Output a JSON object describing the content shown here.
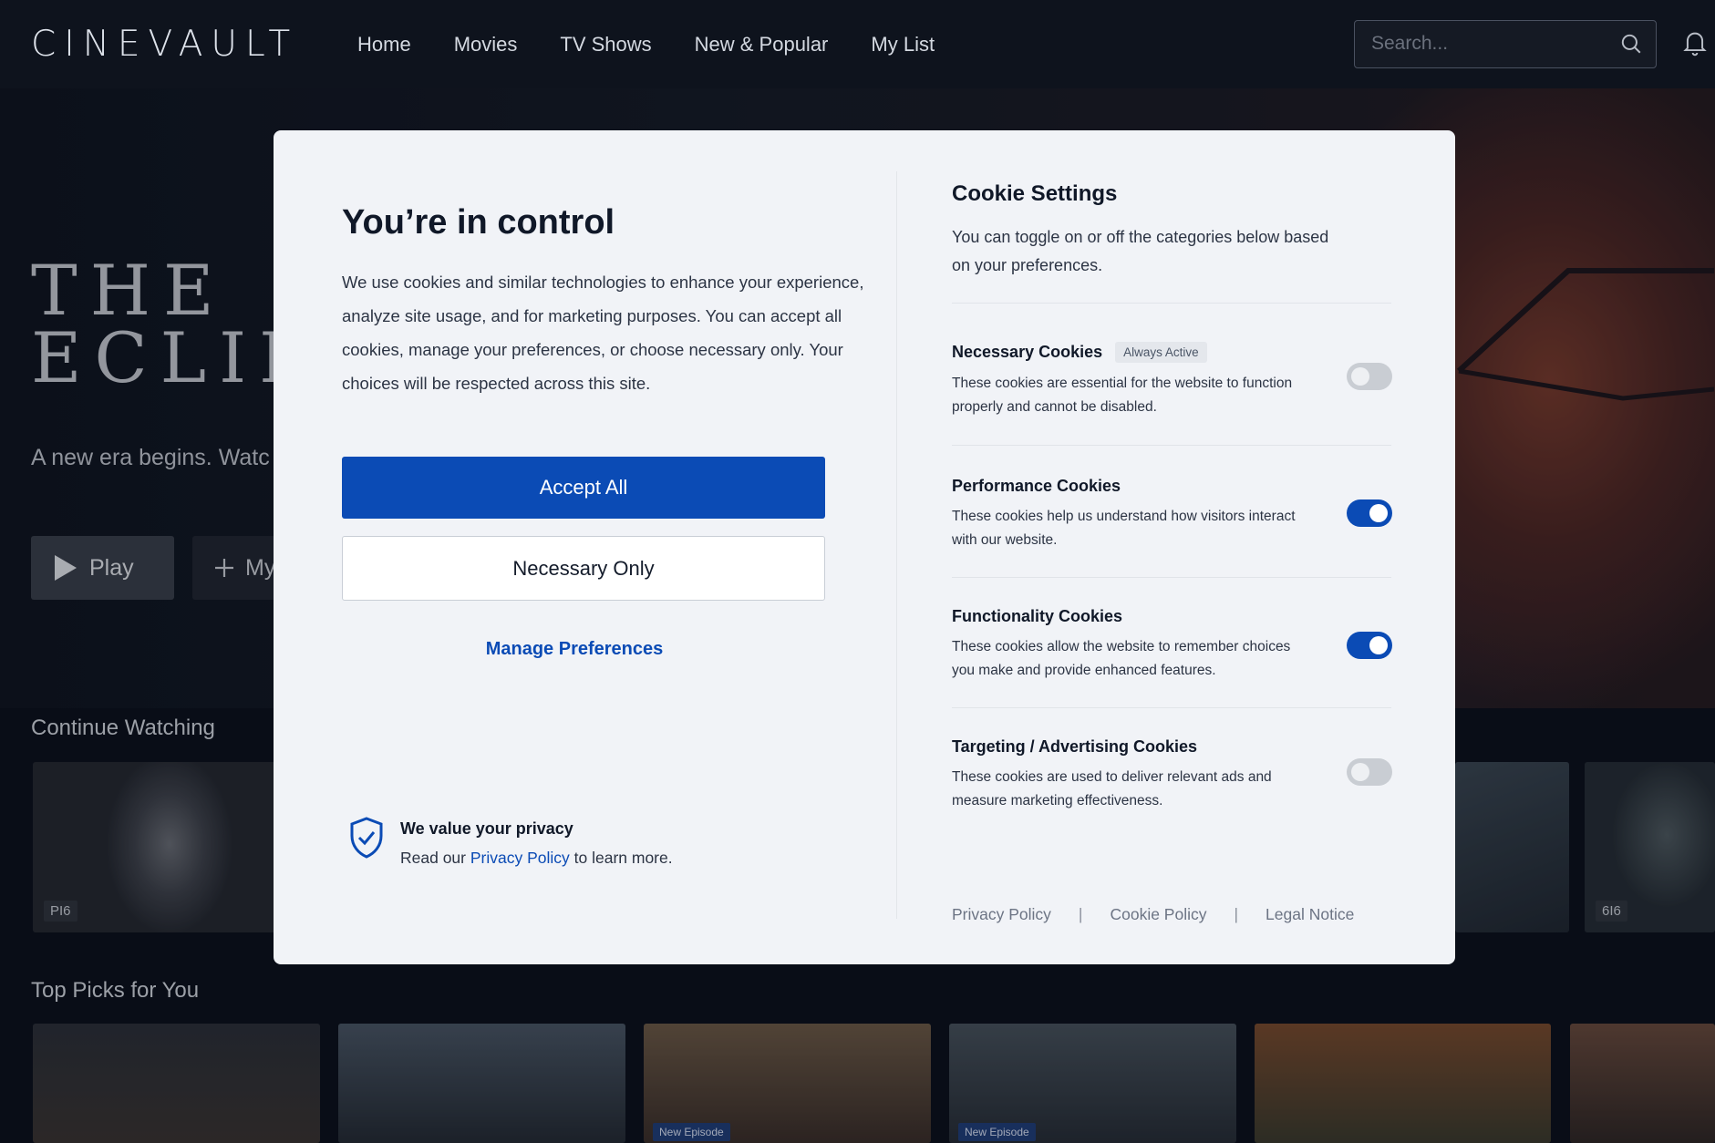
{
  "app": {
    "logo": "CINEVAULT"
  },
  "nav": {
    "items": [
      "Home",
      "Movies",
      "TV Shows",
      "New & Popular",
      "My List"
    ]
  },
  "search": {
    "placeholder": "Search..."
  },
  "hero": {
    "title_line1": "THE",
    "title_line2": "ECLIP",
    "subtitle": "A new era begins. Watc",
    "play_label": "Play",
    "mylist_label": "My"
  },
  "sections": {
    "continue": "Continue Watching",
    "top_picks": "Top Picks for You"
  },
  "badges": {
    "rating1": "PI6",
    "rating2": "6I6",
    "new_episode": "New Episode"
  },
  "modal": {
    "title": "You’re in control",
    "body": "We use cookies and similar technologies to enhance your experience, analyze site usage, and for marketing purposes. You can accept all cookies, manage your preferences, or choose necessary only. Your choices will be respected across this site.",
    "accept_label": "Accept All",
    "necessary_label": "Necessary Only",
    "manage_label": "Manage Preferences",
    "privacy_heading": "We value your privacy",
    "privacy_pre": "Read our ",
    "privacy_link": "Privacy Policy",
    "privacy_post": " to learn more."
  },
  "cookie_settings": {
    "title": "Cookie Settings",
    "description": "You can toggle on or off the categories below based on your preferences.",
    "categories": [
      {
        "name": "Necessary Cookies",
        "tag": "Always Active",
        "description": "These cookies are essential for the website to function properly and cannot be disabled.",
        "enabled": false
      },
      {
        "name": "Performance Cookies",
        "description": "These cookies help us understand how visitors interact with our website.",
        "enabled": true
      },
      {
        "name": "Functionality Cookies",
        "description": "These cookies allow the website to remember choices you make and provide enhanced features.",
        "enabled": true
      },
      {
        "name": "Targeting / Advertising Cookies",
        "description": "These cookies are used to deliver relevant ads and measure marketing effectiveness.",
        "enabled": false
      }
    ]
  },
  "footer_links": [
    "Privacy Policy",
    "Cookie Policy",
    "Legal Notice"
  ],
  "colors": {
    "accent": "#0b4bb5",
    "modal_bg": "#f1f3f7",
    "page_bg": "#0b0f18"
  }
}
